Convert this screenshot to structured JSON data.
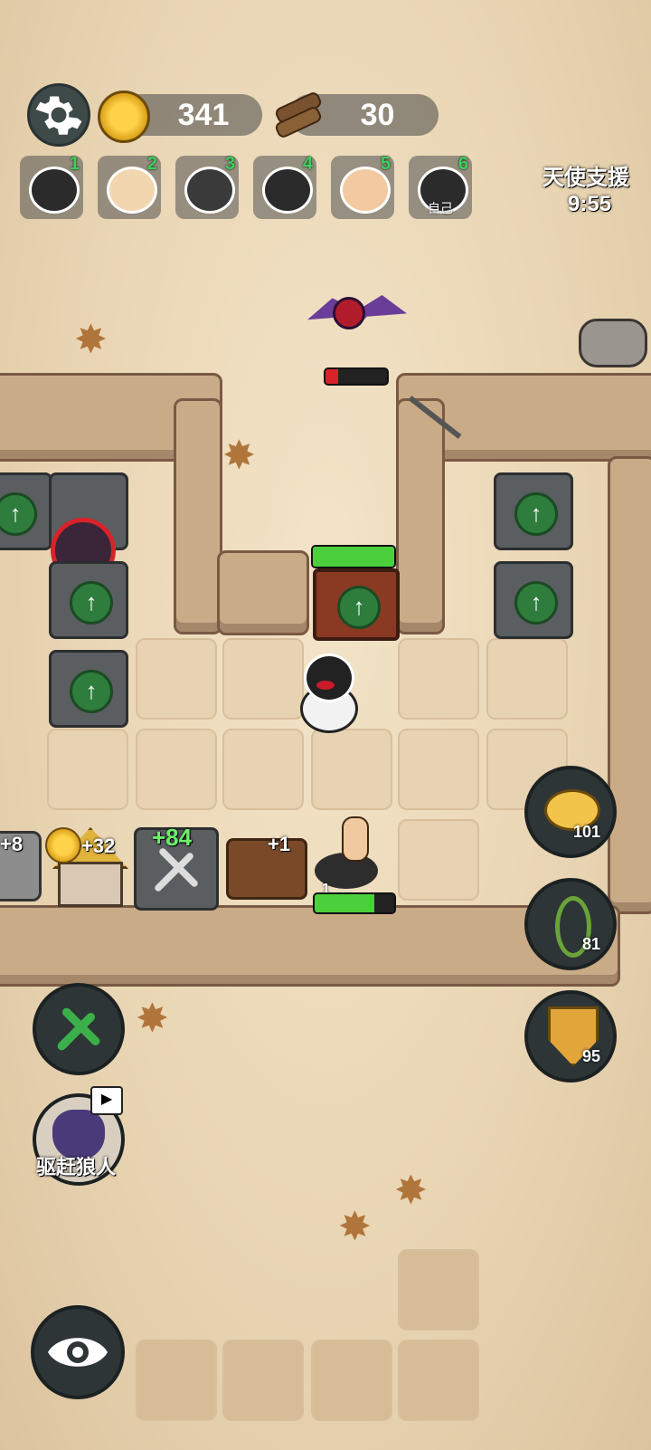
{
  "resources": {
    "coins": "341",
    "wood": "30"
  },
  "players": [
    {
      "num": "1",
      "face": "#2b2b2b",
      "label": ""
    },
    {
      "num": "2",
      "face": "#f2d6b0",
      "label": ""
    },
    {
      "num": "3",
      "face": "#3a3a3a",
      "label": ""
    },
    {
      "num": "4",
      "face": "#2b2b2b",
      "label": ""
    },
    {
      "num": "5",
      "face": "#f2c9a0",
      "label": ""
    },
    {
      "num": "6",
      "face": "#2b2b2b",
      "label": "自己"
    }
  ],
  "event": {
    "title": "天使支援",
    "timer": "9:55"
  },
  "bat_health": 0.2,
  "gate_health": 1.0,
  "ostrich_health": 0.75,
  "ostrich_level": "1",
  "income": {
    "far_left": "+8",
    "house": "+32",
    "tools": "+84",
    "wood": "+1"
  },
  "buttons": {
    "piggy": "101",
    "thorn": "81",
    "shield": "95",
    "wolf_label": "驱赶狼人"
  },
  "icons": {
    "settings": "gear-icon",
    "coin": "coin-icon",
    "wood": "wood-icon",
    "build": "hammer-wrench-icon",
    "wolf": "wolf-icon",
    "video": "video-ad-icon",
    "eye": "eye-icon",
    "piggy": "piggy-bank-icon",
    "thorn": "thorn-vine-icon",
    "shield": "shield-icon"
  },
  "colors": {
    "green": "#3bd15a",
    "red": "#d8232a",
    "accent": "#2e7d3d"
  }
}
